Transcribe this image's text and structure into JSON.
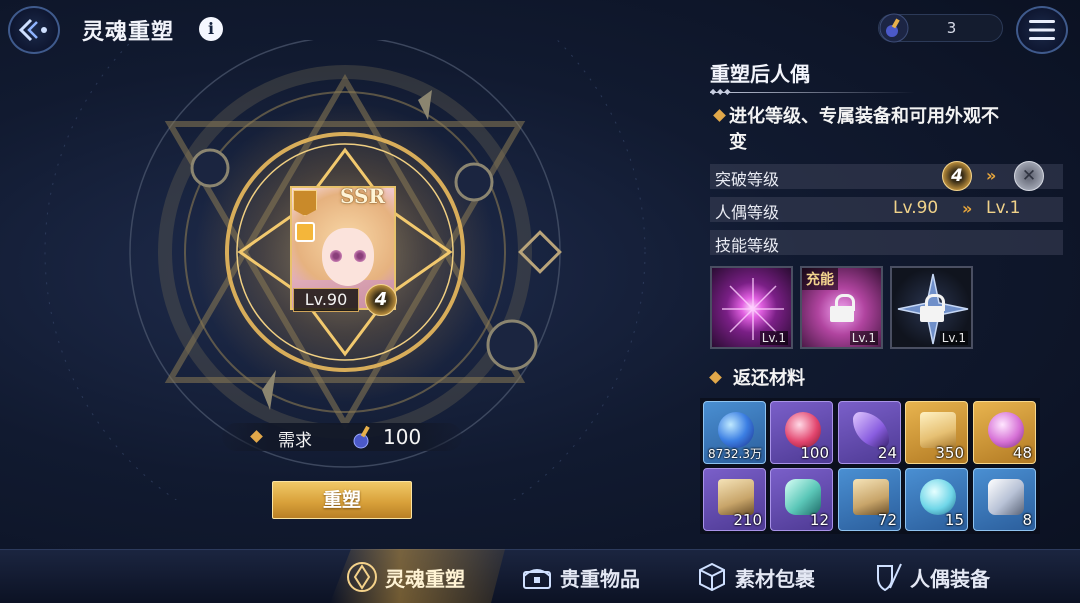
{
  "header": {
    "title": "灵魂重塑",
    "info_label": "i",
    "currency_value": "3"
  },
  "character": {
    "rarity": "SSR",
    "level": "Lv.90",
    "breakthrough": "4"
  },
  "requirement": {
    "label": "需求",
    "value": "100"
  },
  "action": {
    "reshape_label": "重塑"
  },
  "panel": {
    "title": "重塑后人偶",
    "note": "进化等级、专属装备和可用外观不变",
    "stats": [
      {
        "label": "突破等级",
        "from": "4",
        "to": ""
      },
      {
        "label": "人偶等级",
        "from": "Lv.90",
        "to": "Lv.1"
      },
      {
        "label": "技能等级",
        "from": "",
        "to": ""
      }
    ],
    "skills": [
      {
        "level": "Lv.1",
        "tag": ""
      },
      {
        "level": "Lv.1",
        "tag": "充能"
      },
      {
        "level": "Lv.1",
        "tag": ""
      }
    ]
  },
  "materials": {
    "title": "返还材料",
    "items": [
      {
        "qty": "8732.3万"
      },
      {
        "qty": "100"
      },
      {
        "qty": "24"
      },
      {
        "qty": "350"
      },
      {
        "qty": "48"
      },
      {
        "qty": "210"
      },
      {
        "qty": "12"
      },
      {
        "qty": "72"
      },
      {
        "qty": "15"
      },
      {
        "qty": "8"
      }
    ]
  },
  "tabs": [
    {
      "label": "灵魂重塑"
    },
    {
      "label": "贵重物品"
    },
    {
      "label": "素材包裹"
    },
    {
      "label": "人偶装备"
    }
  ],
  "colors": {
    "accent_gold": "#e2a84a",
    "background": "#111a30",
    "stat_value": "#f0d28a"
  }
}
